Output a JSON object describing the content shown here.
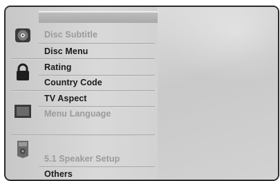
{
  "menu": {
    "items": [
      {
        "label": "Disc Subtitle",
        "state": "dim"
      },
      {
        "label": "Disc Menu",
        "state": "active"
      },
      {
        "label": "Rating",
        "state": "active"
      },
      {
        "label": "Country Code",
        "state": "active"
      },
      {
        "label": "TV Aspect",
        "state": "active"
      },
      {
        "label": "Menu Language",
        "state": "dim"
      },
      {
        "label": "5.1 Speaker Setup",
        "state": "dim"
      },
      {
        "label": "Others",
        "state": "active"
      }
    ]
  },
  "icons": {
    "disc": "disc-icon",
    "lock": "lock-icon",
    "tv": "tv-icon",
    "speaker": "speaker-icon"
  },
  "colors": {
    "active_text": "#1a1a1a",
    "dim_text": "#9a9a9a"
  }
}
